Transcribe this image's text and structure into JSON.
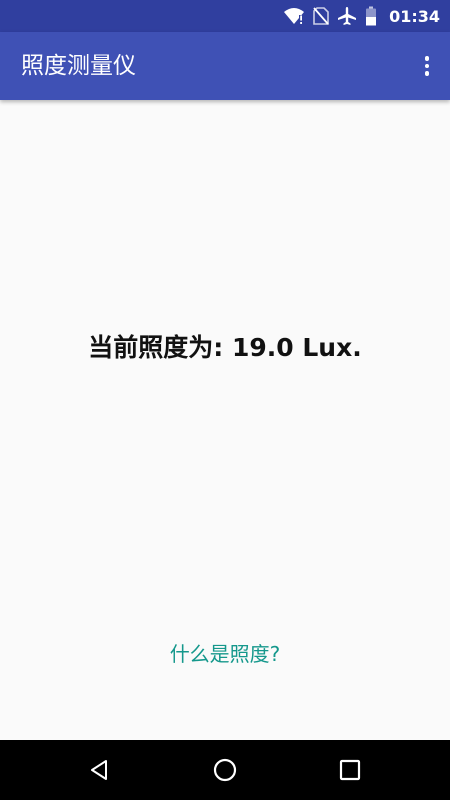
{
  "status_bar": {
    "time": "01:34",
    "icons": [
      "wifi-alert-icon",
      "no-sim-icon",
      "airplane-mode-icon",
      "battery-icon"
    ]
  },
  "app_bar": {
    "title": "照度测量仪",
    "menu_icon": "more-vert-icon"
  },
  "main": {
    "reading_label": "当前照度为: 19.0 Lux.",
    "reading_value": 19.0,
    "reading_unit": "Lux",
    "help_link": "什么是照度?"
  },
  "nav_bar": {
    "buttons": [
      "back-icon",
      "home-icon",
      "recents-icon"
    ]
  },
  "colors": {
    "status_bar": "#303f9f",
    "app_bar": "#3f51b5",
    "background": "#fafafa",
    "link": "#15988c",
    "nav_bar": "#000000"
  }
}
